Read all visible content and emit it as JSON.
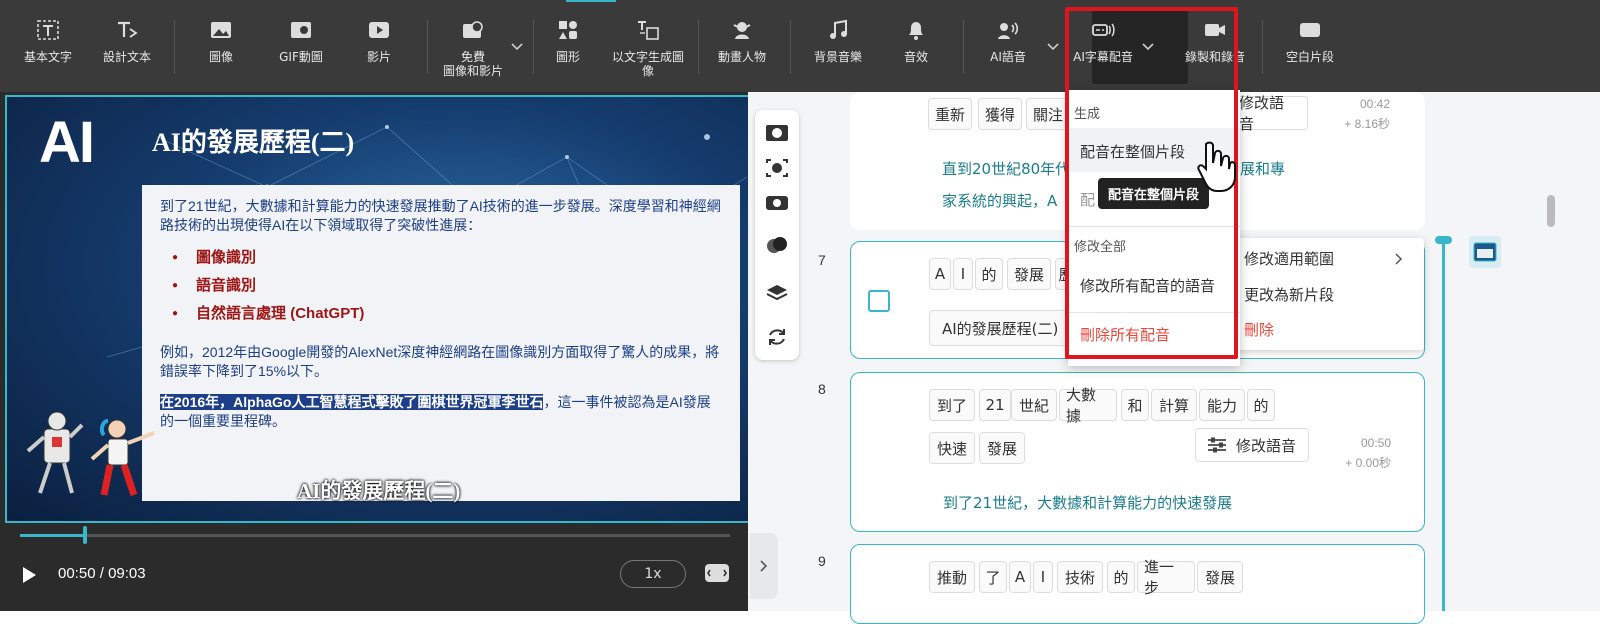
{
  "toolbar": {
    "items": [
      {
        "label": "基本文字",
        "icon": "text-icon"
      },
      {
        "label": "設計文本",
        "icon": "design-text-icon"
      },
      {
        "label": "圖像",
        "icon": "image-icon"
      },
      {
        "label": "GIF動圖",
        "icon": "gif-icon"
      },
      {
        "label": "影片",
        "icon": "video-icon"
      },
      {
        "label": "免費",
        "label2": "圖像和影片",
        "icon": "free-media-icon"
      },
      {
        "label": "圖形",
        "icon": "shapes-icon"
      },
      {
        "label": "以文字生成圖",
        "label2": "像",
        "icon": "text-to-image-icon"
      },
      {
        "label": "動畫人物",
        "icon": "character-icon"
      },
      {
        "label": "背景音樂",
        "icon": "music-icon"
      },
      {
        "label": "音效",
        "icon": "bell-icon"
      },
      {
        "label": "AI語音",
        "icon": "ai-voice-icon"
      },
      {
        "label": "AI字幕配音",
        "icon": "ai-subtitle-dub-icon"
      },
      {
        "label": "錄製和錄音",
        "icon": "record-icon"
      },
      {
        "label": "空白片段",
        "icon": "blank-clip-icon"
      }
    ]
  },
  "slide": {
    "logo": "AI",
    "title": "AI的發展歷程(二)",
    "intro": "到了21世紀，大數據和計算能力的快速發展推動了AI技術的進一步發展。深度學習和神經網路技術的出現使得AI在以下領域取得了突破性進展：",
    "bullets": [
      "圖像識別",
      "語音識別",
      "自然語言處理 (ChatGPT)"
    ],
    "para2": "例如，2012年由Google開發的AlexNet深度神經網路在圖像識別方面取得了驚人的成果，將錯誤率下降到了15%以下。",
    "para3_highlight": "在2016年，AlphaGo人工智慧程式擊敗了圍棋世界冠軍李世石",
    "para3_rest": "，這一事件被認為是AI發展的一個重要里程碑。",
    "caption": "AI的發展歷程(二)"
  },
  "player": {
    "current_time": "00:50",
    "separator": " / ",
    "total_time": "09:03",
    "speed": "1x",
    "progress": 0.092
  },
  "rows": {
    "r6": {
      "words": [
        "重新",
        "獲得",
        "關注"
      ],
      "voice_btn": "修改語音",
      "time": "00:42",
      "duration": "+ 8.16秒",
      "subtitle_1": "直到20世紀80年代",
      "subtitle_1b": "展和專",
      "subtitle_2": "家系統的興起，A"
    },
    "r7": {
      "num": "7",
      "words": [
        "A",
        "I",
        "的",
        "發展",
        "歷"
      ],
      "subtitle_box": "AI的發展歷程(二)"
    },
    "r8": {
      "num": "8",
      "words": [
        "到了",
        "21",
        "世紀",
        "大數據",
        "和",
        "計算",
        "能力",
        "的",
        "快速",
        "發展"
      ],
      "voice_btn": "修改語音",
      "time": "00:50",
      "duration": "+ 0.00秒",
      "subtitle": "到了21世紀，大數據和計算能力的快速發展"
    },
    "r9": {
      "num": "9",
      "words": [
        "推動",
        "了",
        "A",
        "I",
        "技術",
        "的",
        "進一步",
        "發展"
      ]
    }
  },
  "context_menu": {
    "items": [
      "修改適用範圍",
      "更改為新片段",
      "刪除"
    ]
  },
  "dropdown": {
    "section1": "生成",
    "item1": "配音在整個片段",
    "item2": "配",
    "section2": "修改全部",
    "item3": "修改所有配音的語音",
    "item4": "刪除所有配音",
    "tooltip": "配音在整個片段"
  },
  "colors": {
    "accent": "#39b6c9",
    "danger": "#e0141e",
    "delete_text": "#e8483c"
  }
}
